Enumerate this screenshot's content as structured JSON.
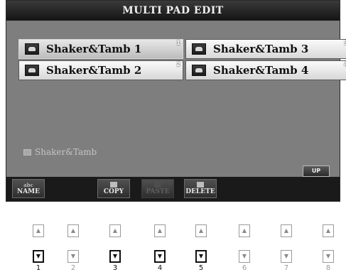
{
  "screen": {
    "title": "MULTI PAD EDIT",
    "pads": [
      {
        "label": "Shaker&Tamb 1",
        "number": "1",
        "selected": true
      },
      {
        "label": "Shaker&Tamb 2",
        "number": "2",
        "selected": false
      },
      {
        "label": "Shaker&Tamb 3",
        "number": "3",
        "selected": false
      },
      {
        "label": "Shaker&Tamb 4",
        "number": "4",
        "selected": false
      }
    ],
    "bank_name": "Shaker&Tamb",
    "up_label": "UP"
  },
  "softkeys": {
    "name_label": "NAME",
    "name_sublabel": "abc",
    "copy_label": "COPY",
    "paste_label": "PASTE",
    "delete_label": "DELETE"
  },
  "hardware_buttons": [
    {
      "number": "1",
      "down_active": true
    },
    {
      "number": "2",
      "down_active": false
    },
    {
      "number": "3",
      "down_active": true
    },
    {
      "number": "4",
      "down_active": true
    },
    {
      "number": "5",
      "down_active": true
    },
    {
      "number": "6",
      "down_active": false
    },
    {
      "number": "7",
      "down_active": false
    },
    {
      "number": "8",
      "down_active": false
    }
  ],
  "glyphs": {
    "up": "▲",
    "down": "▼"
  }
}
